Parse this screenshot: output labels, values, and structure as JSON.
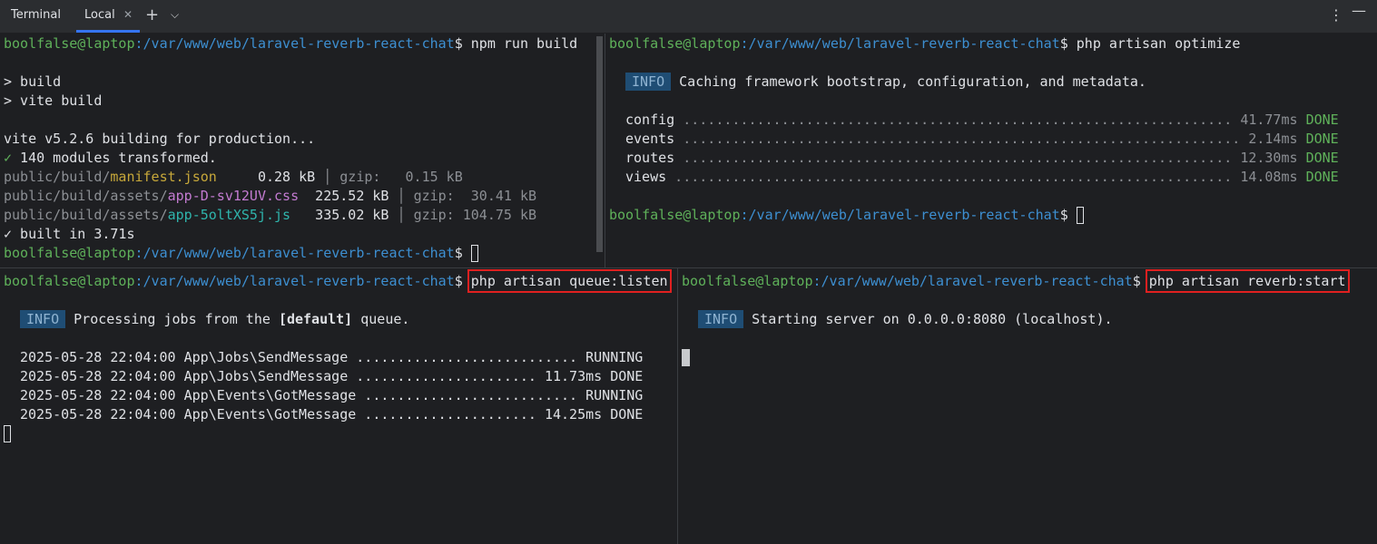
{
  "toolbar": {
    "title": "Terminal",
    "tab_label": "Local",
    "close_glyph": "✕",
    "add_glyph": "+",
    "dropdown_glyph": "⌵",
    "more_glyph": "⋮",
    "minimize_glyph": "—"
  },
  "prompt": {
    "user": "boolfalse@laptop",
    "path": ":/var/www/web/laravel-reverb-react-chat",
    "dollar": "$"
  },
  "pane1": {
    "command": "npm run build",
    "l_build": "> build",
    "l_vite": "> vite build",
    "l_vite_ver": "vite v5.2.6 building for production...",
    "check": "✓",
    "l_modules": " 140 modules transformed.",
    "files": [
      {
        "dir": "public/build/",
        "name": "manifest.json",
        "size": "     0.28 kB",
        "sep": " │ ",
        "gzip": "gzip:   0.15 kB"
      },
      {
        "dir": "public/build/assets/",
        "name": "app-D-sv12UV.css",
        "size": "  225.52 kB",
        "sep": " │ ",
        "gzip": "gzip:  30.41 kB"
      },
      {
        "dir": "public/build/assets/",
        "name": "app-5oltXS5j.js",
        "size": "   335.02 kB",
        "sep": " │ ",
        "gzip": "gzip: 104.75 kB"
      }
    ],
    "l_built": " built in 3.71s"
  },
  "pane2": {
    "command": "php artisan optimize",
    "info": "INFO",
    "info_text": "Caching framework bootstrap, configuration, and metadata.",
    "rows": [
      {
        "name": "config",
        "dots": " ................................................................... ",
        "time": "41.77ms",
        "status": "DONE"
      },
      {
        "name": "events",
        "dots": " .................................................................... ",
        "time": "2.14ms",
        "status": "DONE"
      },
      {
        "name": "routes",
        "dots": " ................................................................... ",
        "time": "12.30ms",
        "status": "DONE"
      },
      {
        "name": "views",
        "dots": " .................................................................... ",
        "time": "14.08ms",
        "status": "DONE"
      }
    ]
  },
  "pane3": {
    "command": "php artisan queue:listen",
    "info": "INFO",
    "info_text_a": "Processing jobs from the ",
    "info_text_b": "[default]",
    "info_text_c": " queue.",
    "jobs": [
      {
        "text": "2025-05-28 22:04:00 App\\Jobs\\SendMessage ........................... ",
        "time": "",
        "status": "RUNNING"
      },
      {
        "text": "2025-05-28 22:04:00 App\\Jobs\\SendMessage ...................... ",
        "time": "11.73ms",
        "status": "DONE"
      },
      {
        "text": "2025-05-28 22:04:00 App\\Events\\GotMessage .......................... ",
        "time": "",
        "status": "RUNNING"
      },
      {
        "text": "2025-05-28 22:04:00 App\\Events\\GotMessage ..................... ",
        "time": "14.25ms",
        "status": "DONE"
      }
    ]
  },
  "pane4": {
    "command": "php artisan reverb:start",
    "info": "INFO",
    "info_text": "Starting server on 0.0.0.0:8080 (localhost)."
  },
  "colors": {
    "background": "#1e1f22",
    "prompt_user": "#5fb15a",
    "prompt_path": "#3d8fd1",
    "highlight_box": "#e02020",
    "info_badge": "#1f4d74"
  }
}
